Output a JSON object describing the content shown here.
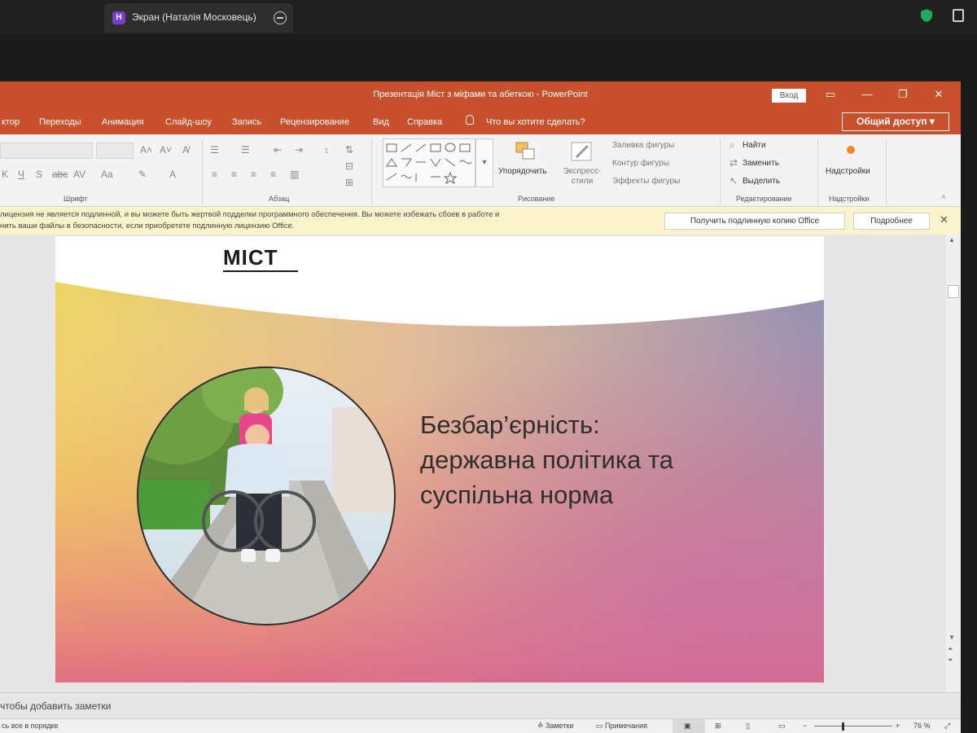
{
  "meeting": {
    "screen_tab": {
      "badge": "Н",
      "title": "Экран (Наталія Московець)"
    }
  },
  "window": {
    "title": "Презентація Міст з міфами та абеткою  -  PowerPoint",
    "login_label": "Вход",
    "controls": {
      "ribbon_display": "▭",
      "minimize": "—",
      "restore": "❐",
      "close": "✕"
    }
  },
  "ribbon_tabs": [
    "ктор",
    "Переходы",
    "Анимация",
    "Слайд-шоу",
    "Запись",
    "Рецензирование",
    "Вид",
    "Справка"
  ],
  "tell_me": "Что вы хотите сделать?",
  "share_button": "Общий доступ",
  "ribbon": {
    "groups": {
      "font": "Шрифт",
      "paragraph": "Абзац",
      "drawing": "Рисование",
      "editing": "Редактирование",
      "addins": "Надстройки"
    },
    "arrange": "Упорядочить",
    "quick_styles": "Экспресс-стили",
    "shape_fill": "Заливка фигуры",
    "shape_outline": "Контур фигуры",
    "shape_effects": "Эффекты фигуры",
    "find": "Найти",
    "replace": "Заменить",
    "select": "Выделить",
    "addins_btn": "Надстройки"
  },
  "message_bar": {
    "line1": "лицензия не является подлинной, и вы можете быть жертвой подделки программного обеспечения. Вы можете избежать сбоев в работе и",
    "line2": "нить ваши файлы в безопасности, если приобретете подлинную лицензию Office.",
    "get_genuine": "Получить подлинную копию Office",
    "learn_more": "Подробнее",
    "close": "✕"
  },
  "slide": {
    "logo": "MICT",
    "title_lines": [
      "Безбар’єрність:",
      "державна політика та",
      "суспільна норма"
    ]
  },
  "notes_placeholder": "чтобы добавить заметки",
  "status": {
    "left": "сь все в порядке",
    "notes": "Заметки",
    "comments": "Примечания",
    "zoom": "76 %"
  },
  "colors": {
    "accent": "#c8502d",
    "message_bar": "#fbf3cc"
  }
}
